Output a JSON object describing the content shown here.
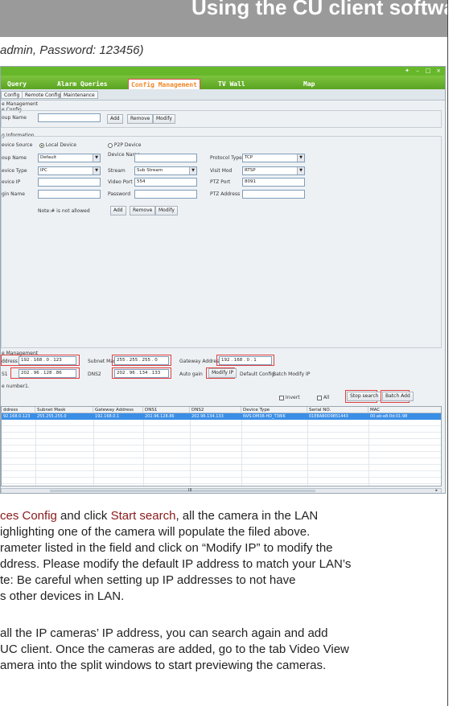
{
  "header": {
    "title": "Using the CU client software"
  },
  "login_note": "admin, Password: 123456)",
  "app": {
    "nav_tabs": [
      "Query",
      "Alarm Queries",
      "Config Management",
      "TV Wall",
      "Map"
    ],
    "active_tab": "Config Management",
    "sub_tabs": [
      "Config",
      "Remote Config",
      "Maintenance"
    ],
    "group_section": "e Management",
    "group_sub": "e Config",
    "group_name_label": "oup Name",
    "group_buttons": [
      "Add",
      "Remove",
      "Modify"
    ],
    "info_section": "g Information",
    "labels": {
      "device_source": "evice Source",
      "local_device": "Local Device",
      "p2p_device": "P2P Device",
      "group_name": "oup Name",
      "device_name": "Device Name",
      "protocol_type": "Protocol Type",
      "device_type": "evice Type",
      "stream": "Stream",
      "visit_mod": "Visit Mod",
      "device_ip": "evice IP",
      "video_port": "Video Port",
      "ptz_port": "PTZ Port",
      "login_name": "gin Name",
      "password": "Password",
      "ptz_address": "PTZ Address"
    },
    "values": {
      "group": "Default",
      "protocol": "TCP",
      "device_type": "IPC",
      "stream": "Sub Stream",
      "visit_mod": "RTSP",
      "video_port": "554",
      "ptz_port": "8091"
    },
    "note": "Note:# is not allowed",
    "info_buttons": [
      "Add",
      "Remove",
      "Modify"
    ],
    "mgmt_section": "e Management",
    "ip_label": "ddress",
    "ip_value": "192 . 168 . 0 . 123",
    "subnet_label": "Subnet Mask",
    "subnet_value": "255 . 255 . 255 . 0",
    "gateway_label": "Gateway Address",
    "gateway_value": "192 . 168 . 0 . 1",
    "dns1_label": "S1",
    "dns1_value": "202 . 96 . 128 . 86",
    "dns2_label": "DNS2",
    "dns2_value": "202 . 96 . 134 . 133",
    "auto_gain": "Auto gain",
    "modify_ip": "Modify IP",
    "default_config": "Default Config",
    "batch_modify_ip": "Batch Modify IP",
    "device_number_label": "e number",
    "device_number_value": "1.",
    "invert": "Invert",
    "all": "All",
    "stop_search": "Stop search",
    "batch_add": "Batch Add",
    "table_headers": [
      "ddress",
      "Subnet Mask",
      "Gateway Address",
      "DNS1",
      "DNS2",
      "Device Type",
      "Serial NO.",
      "MAC"
    ],
    "table_row": [
      "92.168.0.123",
      "255.255.255.0",
      "192.168.0.1",
      "202.96.128.86",
      "202.96.134.133",
      "NVS-DM38-HD_T38IK",
      "01E8AB0D9851443",
      "00:ab:e8:0d:01:98"
    ],
    "scroll_mid": "III"
  },
  "body_lines": [
    [
      "ces Config",
      " and click ",
      "Start search",
      ", all the camera in the LAN"
    ],
    [
      "ighlighting one of the camera will populate the filed above."
    ],
    [
      "rameter listed in the field and click on “Modify IP” to modify the"
    ],
    [
      "ddress. Please modify the default IP address to match your LAN’s"
    ],
    [
      "te: Be careful when setting up IP addresses to not have"
    ],
    [
      "s other devices in LAN."
    ],
    [
      ""
    ],
    [
      "all the IP cameras’ IP address, you can search again and add"
    ],
    [
      "UC client. Once the cameras are added, go to the tab Video View"
    ],
    [
      "amera into the split windows to start previewing the cameras."
    ]
  ],
  "colors": {
    "app_green": "#66b82a",
    "header_gray": "#9a9a9a",
    "highlight_text": "#8a1a1a",
    "selected_row": "#3a8ee6",
    "red_box": "#e04040"
  }
}
